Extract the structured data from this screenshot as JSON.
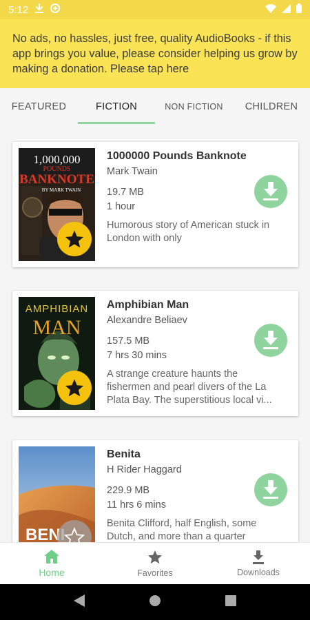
{
  "status_bar": {
    "time": "5:12",
    "icons": [
      "download-icon",
      "sync-icon",
      "wifi-icon",
      "signal-icon",
      "battery-icon"
    ]
  },
  "banner": {
    "text": "No ads, no hassles, just free, quality AudioBooks - if this app brings you value, please consider helping us grow by making a donation. Please tap here"
  },
  "tabs": [
    {
      "label": "FEATURED",
      "active": false
    },
    {
      "label": "FICTION",
      "active": true
    },
    {
      "label": "NON FICTION",
      "active": false
    },
    {
      "label": "CHILDREN",
      "active": false
    }
  ],
  "books": [
    {
      "cover_text": [
        "1,000,000",
        "POUNDS",
        "BANKNOTE",
        "BY MARK TWAIN"
      ],
      "title": "1000000 Pounds Banknote",
      "author": "Mark Twain",
      "size": "19.7 MB",
      "duration": "1 hour",
      "description": "Humorous story of American stuck in London with only"
    },
    {
      "cover_text": [
        "AMPHIBIAN",
        "MAN"
      ],
      "title": "Amphibian Man",
      "author": "Alexandre Beliaev",
      "size": "157.5 MB",
      "duration": "7 hrs 30 mins",
      "description": "A strange creature haunts the fishermen and pearl divers of the La Plata Bay. The superstitious local vi..."
    },
    {
      "cover_text": [
        "BENI"
      ],
      "title": "Benita",
      "author": "H Rider Haggard",
      "size": "229.9 MB",
      "duration": "11 hrs 6 mins",
      "description": "Benita Clifford, half English, some Dutch, and more than a quarter"
    }
  ],
  "bottom_nav": [
    {
      "label": "Home",
      "icon": "home-icon",
      "active": true
    },
    {
      "label": "Favorites",
      "icon": "star-icon",
      "active": false
    },
    {
      "label": "Downloads",
      "icon": "download-icon",
      "active": false
    }
  ],
  "colors": {
    "status_bar": "#f3d84a",
    "banner": "#fbe356",
    "accent_green": "#8fd39f",
    "active_nav": "#6fcf88",
    "star_badge": "#f4c20d"
  }
}
